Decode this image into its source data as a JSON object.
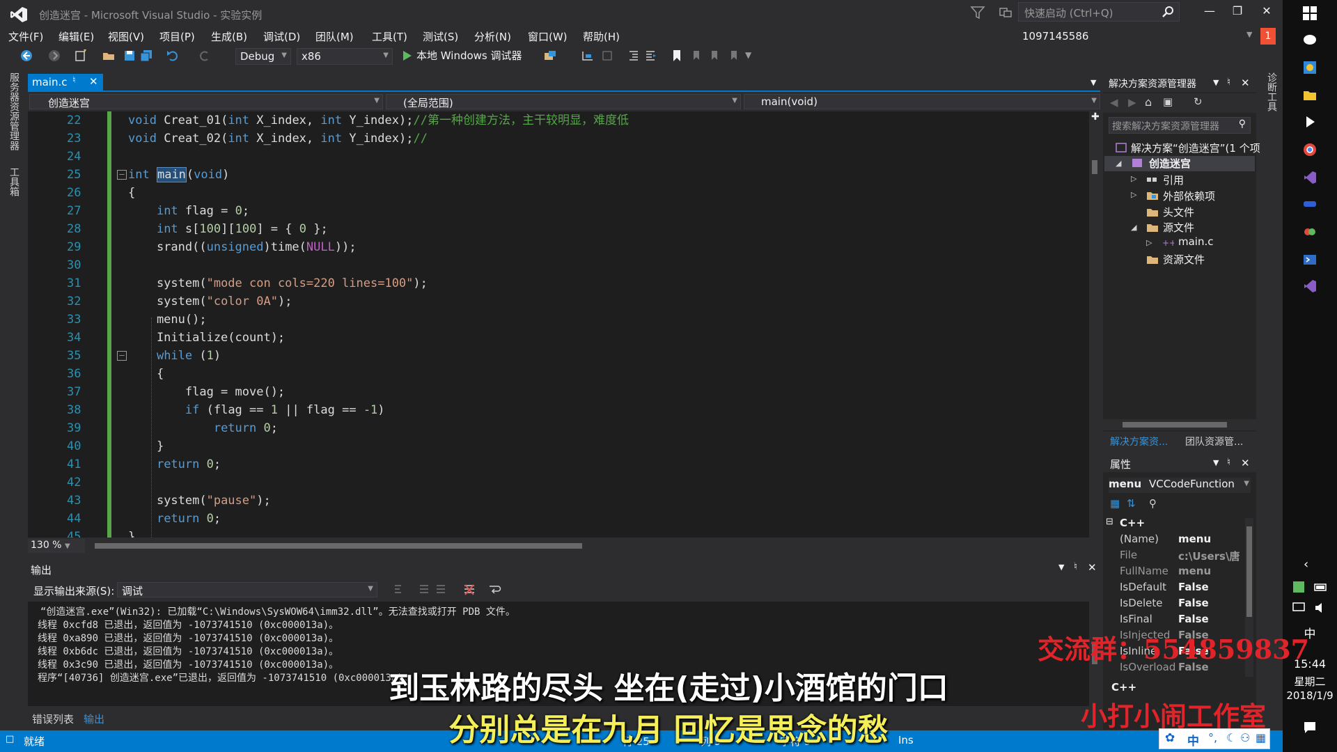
{
  "window": {
    "title": "创造迷宫 - Microsoft Visual Studio - 实验实例",
    "quick_launch_placeholder": "快速启动 (Ctrl+Q)",
    "user": "1097145586",
    "feedback_count": "1"
  },
  "menu": [
    "文件(F)",
    "编辑(E)",
    "视图(V)",
    "项目(P)",
    "生成(B)",
    "调试(D)",
    "团队(M)",
    "工具(T)",
    "测试(S)",
    "分析(N)",
    "窗口(W)",
    "帮助(H)"
  ],
  "toolbar": {
    "config": "Debug",
    "platform": "x86",
    "run_label": "本地 Windows 调试器"
  },
  "left_tabs": [
    "服务器资源管理器",
    "工具箱"
  ],
  "right_tabs": [
    "诊断工具"
  ],
  "editor": {
    "tab_name": "main.c",
    "nav_project": "创造迷宫",
    "nav_scope": "(全局范围)",
    "nav_member": "main(void)",
    "zoom": "130 %",
    "line_numbers": [
      "22",
      "23",
      "24",
      "25",
      "26",
      "27",
      "28",
      "29",
      "30",
      "31",
      "32",
      "33",
      "34",
      "35",
      "36",
      "37",
      "38",
      "39",
      "40",
      "41",
      "42",
      "43",
      "44",
      "45"
    ]
  },
  "output": {
    "title": "输出",
    "source_label": "显示输出来源(S):",
    "source_value": "调试",
    "lines": [
      "“创造迷宫.exe”(Win32): 已加载“C:\\Windows\\SysWOW64\\imm32.dll”。无法查找或打开 PDB 文件。",
      "线程 0xcfd8 已退出，返回值为 -1073741510 (0xc000013a)。",
      "线程 0xa890 已退出，返回值为 -1073741510 (0xc000013a)。",
      "线程 0xb6dc 已退出，返回值为 -1073741510 (0xc000013a)。",
      "线程 0x3c90 已退出，返回值为 -1073741510 (0xc000013a)。",
      "程序“[40736] 创造迷宫.exe”已退出，返回值为 -1073741510 (0xc000013a)。"
    ],
    "tabs": [
      "错误列表",
      "输出"
    ]
  },
  "solution": {
    "title": "解决方案资源管理器",
    "search_placeholder": "搜索解决方案资源管理器",
    "tree": [
      "解决方案“创造迷宫”(1 个项",
      "创造迷宫",
      "引用",
      "外部依赖项",
      "头文件",
      "源文件",
      "main.c",
      "资源文件"
    ],
    "tabs": [
      "解决方案资...",
      "团队资源管..."
    ]
  },
  "properties": {
    "title": "属性",
    "object_name": "menu",
    "object_type": "VCCodeFunction",
    "category": "C++",
    "rows": [
      {
        "name": "(Name)",
        "value": "menu"
      },
      {
        "name": "File",
        "value": "c:\\Users\\唐"
      },
      {
        "name": "FullName",
        "value": "menu"
      },
      {
        "name": "IsDefault",
        "value": "False"
      },
      {
        "name": "IsDelete",
        "value": "False"
      },
      {
        "name": "IsFinal",
        "value": "False"
      },
      {
        "name": "IsInjected",
        "value": "False"
      },
      {
        "name": "IsInline",
        "value": "False"
      },
      {
        "name": "IsOverload",
        "value": "False"
      }
    ],
    "footer": "C++"
  },
  "status": {
    "ready": "就绪",
    "row": "行 25",
    "col": "列 9",
    "char": "字符 9",
    "ins": "Ins"
  },
  "taskbar": {
    "ime": "中",
    "time": "15:44",
    "day": "星期二",
    "date": "2018/1/9"
  },
  "overlays": {
    "group": "交流群：554859837",
    "studio": "小打小闹工作室",
    "subtitle1": "到玉林路的尽头 坐在(走过)小酒馆的门口",
    "subtitle2": "分别总是在九月 回忆是思念的愁",
    "ime_label": "中"
  },
  "colors": {
    "accent": "#007acc",
    "editor_bg": "#1e1e1e",
    "keyword": "#569cd6",
    "comment": "#57a64a",
    "string": "#d69d85"
  }
}
